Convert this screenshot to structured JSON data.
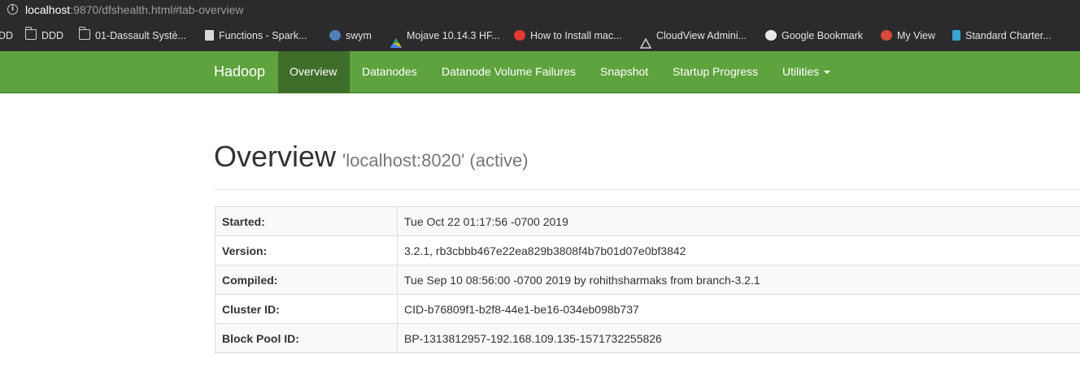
{
  "browser": {
    "url_host": "localhost",
    "url_path": ":9870/dfshealth.html#tab-overview"
  },
  "bookmarks": [
    {
      "label": "DD",
      "icon": "none"
    },
    {
      "label": "DDD",
      "icon": "folder-icon"
    },
    {
      "label": "01-Dassault Systè...",
      "icon": "folder-icon"
    },
    {
      "label": "Functions - Spark...",
      "icon": "book-icon"
    },
    {
      "label": "swym",
      "icon": "swym-icon"
    },
    {
      "label": "Mojave 10.14.3 HF...",
      "icon": "google-drive-icon"
    },
    {
      "label": "How to Install mac...",
      "icon": "site-icon"
    },
    {
      "label": "CloudView Admini...",
      "icon": "cloudview-icon"
    },
    {
      "label": "Google Bookmark",
      "icon": "globe-icon"
    },
    {
      "label": "My View",
      "icon": "myview-icon"
    },
    {
      "label": "Standard Charter...",
      "icon": "standard-chartered-icon"
    }
  ],
  "navbar": {
    "brand": "Hadoop",
    "items": [
      {
        "label": "Overview",
        "active": true
      },
      {
        "label": "Datanodes",
        "active": false
      },
      {
        "label": "Datanode Volume Failures",
        "active": false
      },
      {
        "label": "Snapshot",
        "active": false
      },
      {
        "label": "Startup Progress",
        "active": false
      },
      {
        "label": "Utilities",
        "active": false,
        "dropdown": true
      }
    ],
    "color": "#5fa33e",
    "active_color": "#3f6d2a"
  },
  "page": {
    "title": "Overview",
    "subtitle": "'localhost:8020' (active)"
  },
  "overview_table": [
    {
      "key": "Started:",
      "value": "Tue Oct 22 01:17:56 -0700 2019"
    },
    {
      "key": "Version:",
      "value": "3.2.1, rb3cbbb467e22ea829b3808f4b7b01d07e0bf3842"
    },
    {
      "key": "Compiled:",
      "value": "Tue Sep 10 08:56:00 -0700 2019 by rohithsharmaks from branch-3.2.1"
    },
    {
      "key": "Cluster ID:",
      "value": "CID-b76809f1-b2f8-44e1-be16-034eb098b737"
    },
    {
      "key": "Block Pool ID:",
      "value": "BP-1313812957-192.168.109.135-1571732255826"
    }
  ]
}
